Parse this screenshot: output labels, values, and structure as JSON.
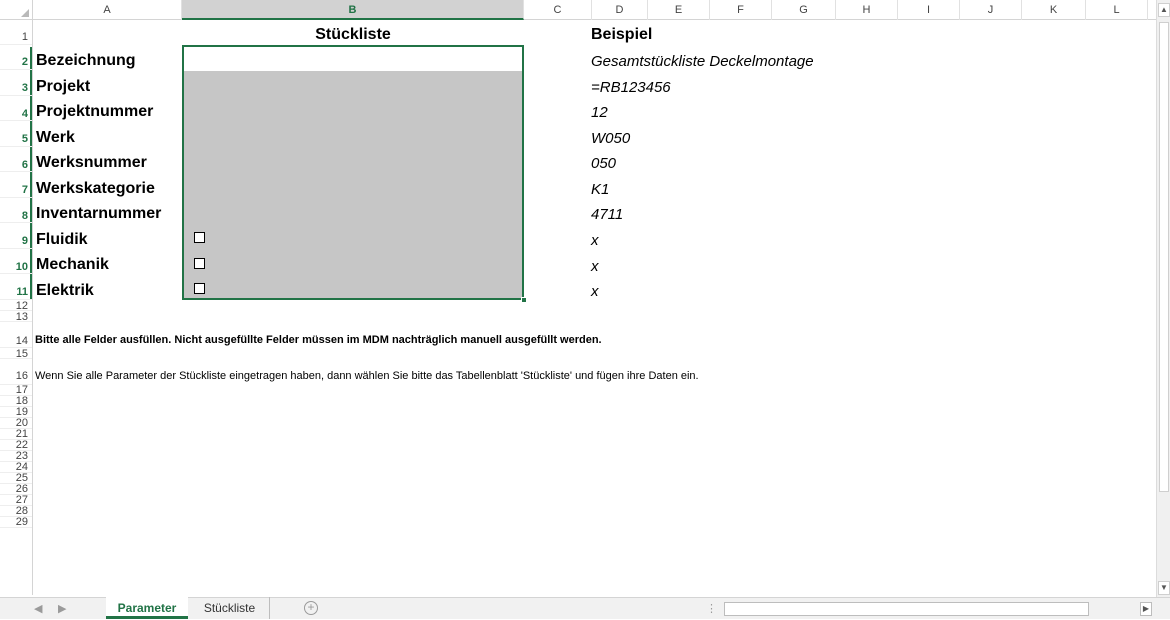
{
  "columns": [
    "A",
    "B",
    "C",
    "D",
    "E",
    "F",
    "G",
    "H",
    "I",
    "J",
    "K",
    "L"
  ],
  "rows": [
    "1",
    "2",
    "3",
    "4",
    "5",
    "6",
    "7",
    "8",
    "9",
    "10",
    "11",
    "12",
    "13",
    "14",
    "15",
    "16",
    "17",
    "18",
    "19",
    "20",
    "21",
    "22",
    "23",
    "24",
    "25",
    "26",
    "27",
    "28",
    "29"
  ],
  "header_b": "Stückliste",
  "header_d": "Beispiel",
  "labels": [
    "Bezeichnung",
    "Projekt",
    "Projektnummer",
    "Werk",
    "Werksnummer",
    "Werkskategorie",
    "Inventarnummer",
    "Fluidik",
    "Mechanik",
    "Elektrik"
  ],
  "examples": [
    "Gesamtstückliste Deckelmontage",
    "=RB123456",
    "12",
    "W050",
    "050",
    "K1",
    "4711",
    "x",
    "x",
    "x"
  ],
  "note1": "Bitte alle Felder ausfüllen. Nicht ausgefüllte Felder müssen im MDM nachträglich manuell ausgefüllt werden.",
  "note2": "Wenn Sie alle Parameter der Stückliste eingetragen haben, dann wählen Sie bitte das Tabellenblatt 'Stückliste' und fügen ihre Daten ein.",
  "tabs": {
    "active": "Parameter",
    "other": "Stückliste",
    "add": "+"
  },
  "nav": {
    "prev": "◀",
    "next": "▶"
  },
  "colors": {
    "accent": "#217346",
    "selection_fill": "#c6c6c6"
  }
}
